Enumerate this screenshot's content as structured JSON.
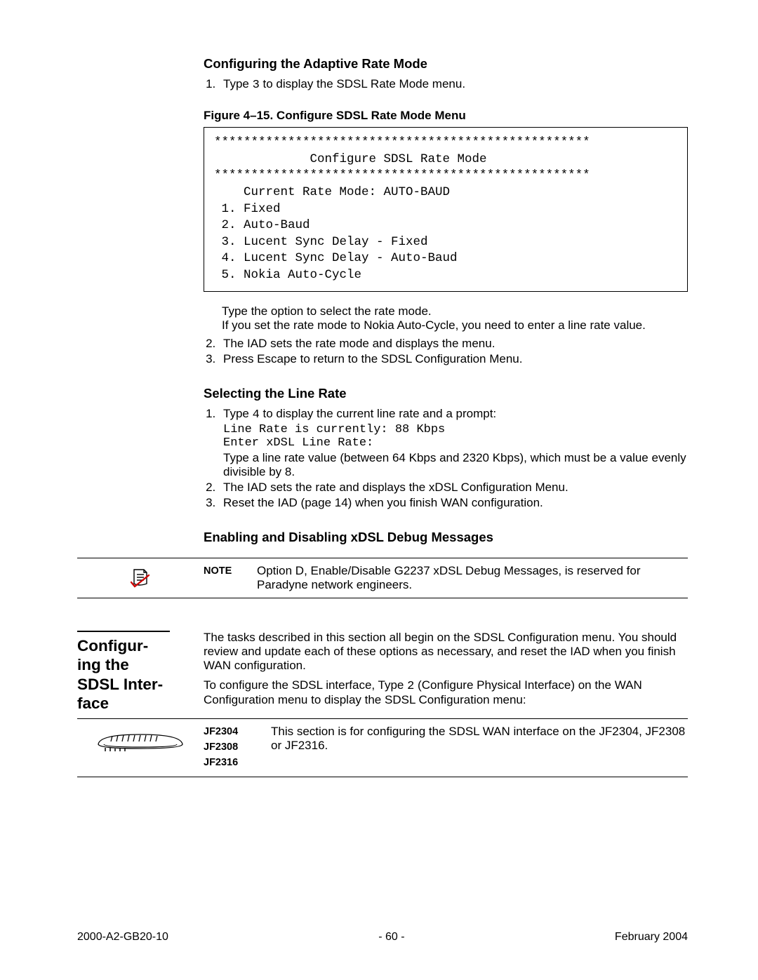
{
  "section1": {
    "heading": "Configuring the Adaptive Rate Mode",
    "step1": "Type 3 to display the SDSL Rate Mode menu.",
    "fig_caption": "Figure 4–15.  Configure SDSL Rate Mode Menu",
    "codebox": "***************************************************\n             Configure SDSL Rate Mode\n***************************************************\n    Current Rate Mode: AUTO-BAUD\n 1. Fixed\n 2. Auto-Baud\n 3. Lucent Sync Delay - Fixed\n 4. Lucent Sync Delay - Auto-Baud\n 5. Nokia Auto-Cycle",
    "after1": "Type the option to select the rate mode.",
    "after2": "If you set the rate mode to Nokia Auto-Cycle, you need to enter a line rate value.",
    "step2": "The IAD sets the rate mode and displays the menu.",
    "step3": "Press Escape to return to the SDSL Configuration Menu."
  },
  "section2": {
    "heading": "Selecting the Line Rate",
    "step1_intro": "Type 4 to display the current line rate and a prompt:",
    "step1_code": "Line Rate is currently: 88 Kbps\nEnter xDSL Line Rate:",
    "step1_cont": "Type a line rate value (between 64 Kbps and 2320 Kbps), which must be a value evenly divisible by 8.",
    "step2": "The IAD sets the rate and displays the xDSL Configuration Menu.",
    "step3": "Reset the IAD (page 14) when you finish WAN configuration."
  },
  "section3": {
    "heading": "Enabling and Disabling xDSL Debug Messages",
    "note_label": "NOTE",
    "note_text": "Option D, Enable/Disable G2237 xDSL Debug Messages, is reserved for Paradyne network engineers."
  },
  "section4": {
    "title": "Configur­ing the SDSL Inter­face",
    "para1": "The tasks described in this section all begin on the SDSL Configuration menu. You should review and update each of these options as necessary, and reset the IAD when you finish WAN configuration.",
    "para2_a": "To configure the SDSL interface, Type ",
    "para2_code": "2",
    "para2_b": " (Configure Physical Interface) on the WAN Configuration menu to display the SDSL Configuration menu:",
    "device_tags": [
      "JF2304",
      "JF2308",
      "JF2316"
    ],
    "device_text": "This section is for configuring the SDSL WAN interface on the JF2304, JF2308 or JF2316."
  },
  "footer": {
    "left": "2000-A2-GB20-10",
    "center": "- 60 -",
    "right": "February 2004"
  }
}
